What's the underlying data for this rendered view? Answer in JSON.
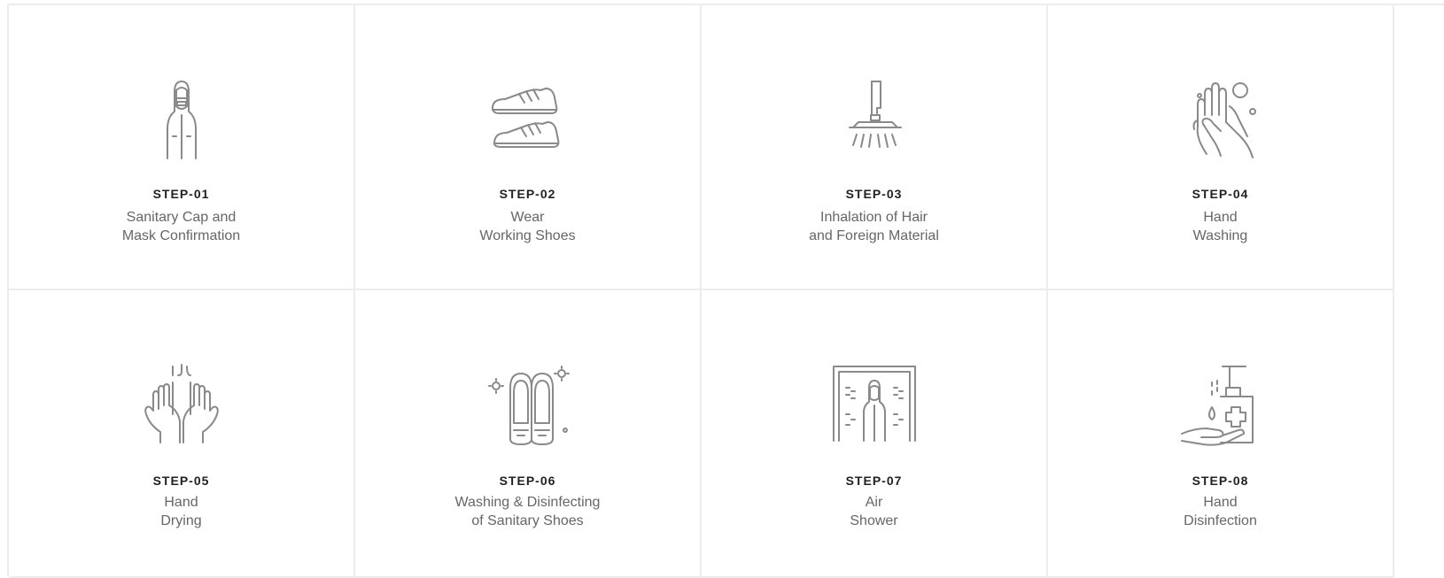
{
  "steps": [
    {
      "step": "STEP-01",
      "line1": "Sanitary Cap and",
      "line2": "Mask Confirmation",
      "icon": "protective-suit-icon"
    },
    {
      "step": "STEP-02",
      "line1": "Wear",
      "line2": "Working Shoes",
      "icon": "working-shoes-icon"
    },
    {
      "step": "STEP-03",
      "line1": "Inhalation of Hair",
      "line2": "and Foreign Material",
      "icon": "vacuum-cleaner-icon"
    },
    {
      "step": "STEP-04",
      "line1": "Hand",
      "line2": "Washing",
      "icon": "hand-washing-icon"
    },
    {
      "step": "STEP-05",
      "line1": "Hand",
      "line2": "Drying",
      "icon": "hand-drying-icon"
    },
    {
      "step": "STEP-06",
      "line1": "Washing & Disinfecting",
      "line2": "of Sanitary Shoes",
      "icon": "shoe-disinfection-icon"
    },
    {
      "step": "STEP-07",
      "line1": "Air",
      "line2": "Shower",
      "icon": "air-shower-icon"
    },
    {
      "step": "STEP-08",
      "line1": "Hand",
      "line2": "Disinfection",
      "icon": "hand-sanitizer-icon"
    }
  ],
  "colors": {
    "border": "#ececec",
    "icon_stroke": "#8a8a8a",
    "step_text": "#222222",
    "desc_text": "#666666"
  }
}
